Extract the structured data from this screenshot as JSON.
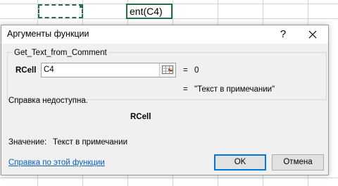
{
  "spreadsheet": {
    "editing_cell_text": "ent(C4)",
    "accent_color": "#217346"
  },
  "dialog": {
    "title": "Аргументы функции",
    "help_button": "?",
    "close_icon": "close-icon",
    "function_name": "Get_Text_from_Comment",
    "argument": {
      "label": "RCell",
      "value": "C4",
      "range_icon": "range-select-icon",
      "equals": "=",
      "result": "0"
    },
    "function_result": {
      "equals": "=",
      "value": "\"Текст в примечании\""
    },
    "help_unavailable": "Справка недоступна.",
    "argument_description": "RCell",
    "value_label": "Значение:",
    "value_text": "Текст в примечании",
    "help_link": "Справка по этой функции",
    "ok_label": "OK",
    "cancel_label": "Отмена",
    "link_color": "#0a5fbf",
    "focus_color": "#0078d7"
  }
}
